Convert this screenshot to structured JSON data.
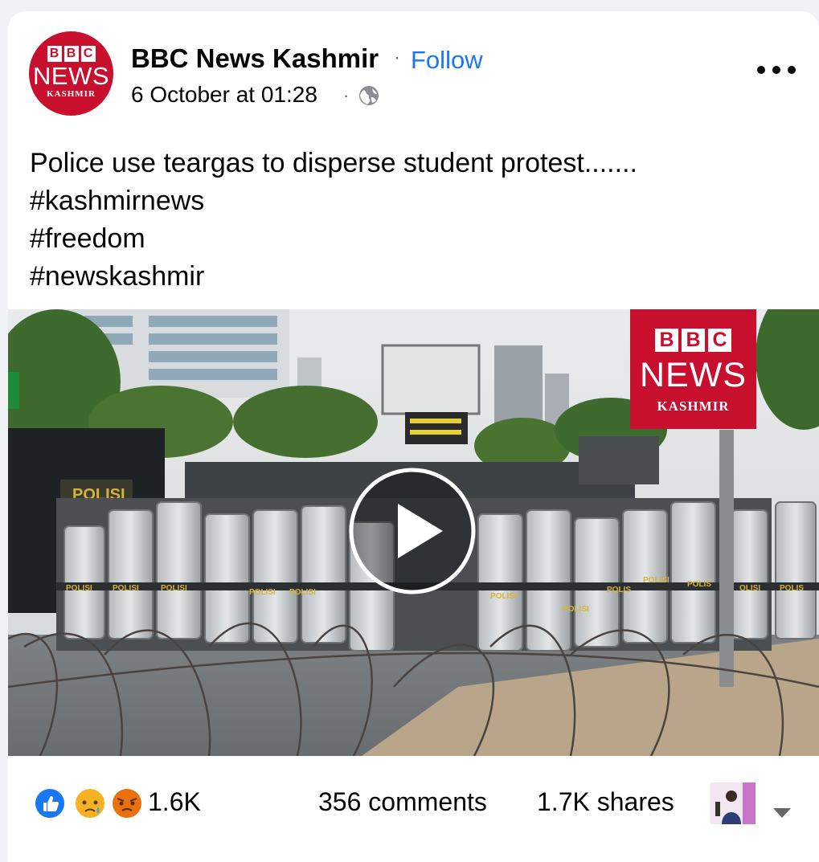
{
  "post": {
    "page_name": "BBC News Kashmir",
    "follow_label": "Follow",
    "timestamp": "6 October at 01:28",
    "privacy_icon": "globe-icon",
    "more_icon": "more-options-icon",
    "text_lines": [
      "Police use teargas to disperse student protest.......",
      "#kashmirnews",
      "#freedom",
      "#newskashmir"
    ]
  },
  "avatar": {
    "bbc_letters": [
      "B",
      "B",
      "C"
    ],
    "news": "NEWS",
    "region": "KASHMIR"
  },
  "video": {
    "badge_letters": [
      "B",
      "B",
      "C"
    ],
    "badge_news": "NEWS",
    "badge_region": "KASHMIR",
    "play_icon": "play-icon"
  },
  "footer": {
    "reaction_icons": [
      "like-icon",
      "sad-icon",
      "angry-icon"
    ],
    "reaction_count": "1.6K",
    "comments": "356 comments",
    "shares": "1.7K shares"
  },
  "colors": {
    "bbc_red": "#c8102e",
    "link_blue": "#1877f2",
    "like_blue": "#1877f2",
    "reaction_yellow": "#f7b125",
    "angry_orange": "#e9710f"
  }
}
